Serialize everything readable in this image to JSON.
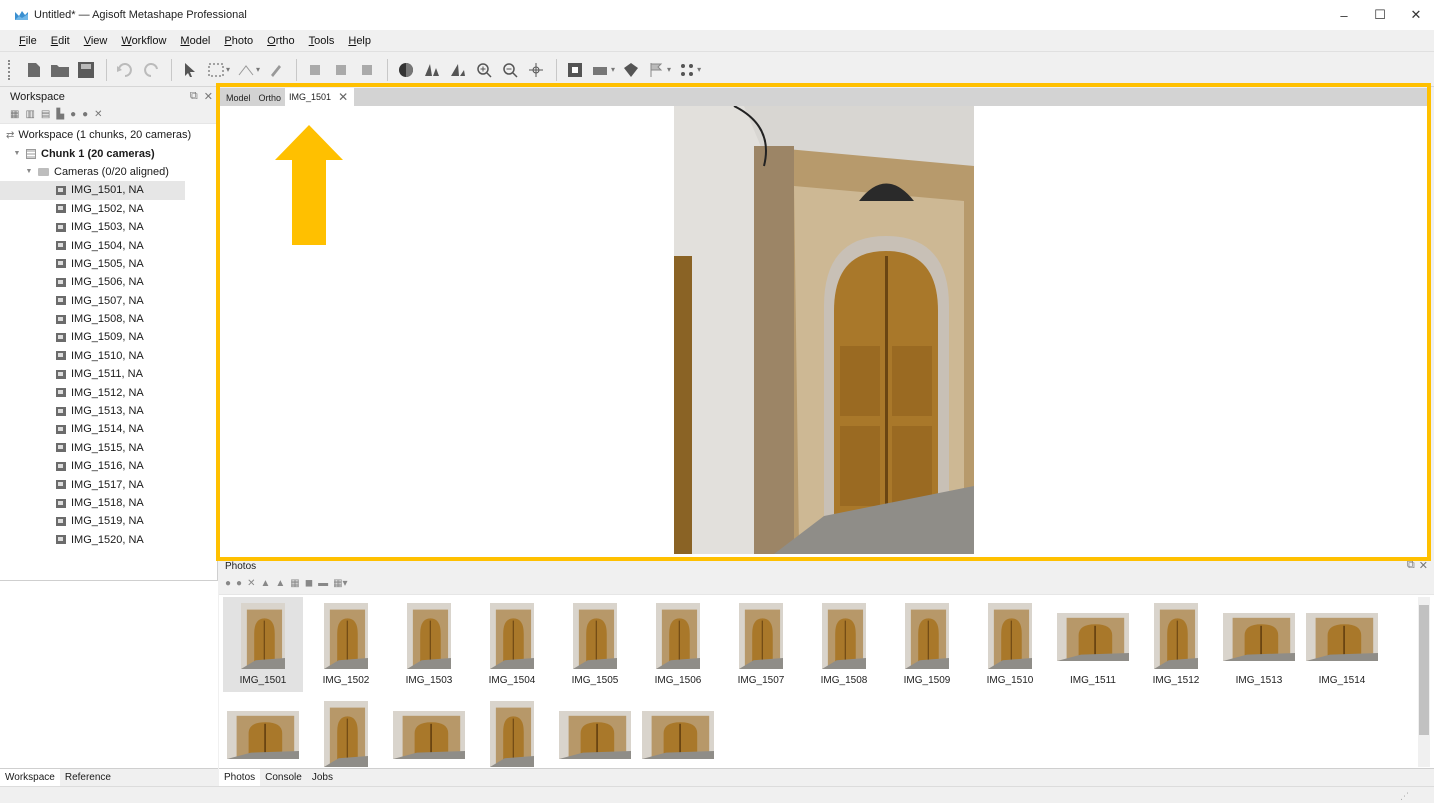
{
  "window": {
    "title": "Untitled* — Agisoft Metashape Professional"
  },
  "window_controls": {
    "minimize": "–",
    "maximize": "☐",
    "close": "✕"
  },
  "menu": [
    {
      "pre": "",
      "u": "F",
      "post": "ile"
    },
    {
      "pre": "",
      "u": "E",
      "post": "dit"
    },
    {
      "pre": "",
      "u": "V",
      "post": "iew"
    },
    {
      "pre": "",
      "u": "W",
      "post": "orkflow"
    },
    {
      "pre": "",
      "u": "M",
      "post": "odel"
    },
    {
      "pre": "",
      "u": "P",
      "post": "hoto"
    },
    {
      "pre": "",
      "u": "O",
      "post": "rtho"
    },
    {
      "pre": "",
      "u": "T",
      "post": "ools"
    },
    {
      "pre": "",
      "u": "H",
      "post": "elp"
    }
  ],
  "workspace": {
    "title": "Workspace",
    "root": "Workspace (1 chunks, 20 cameras)",
    "chunk": "Chunk 1 (20 cameras)",
    "cameras_folder": "Cameras (0/20 aligned)",
    "cameras": [
      "IMG_1501, NA",
      "IMG_1502, NA",
      "IMG_1503, NA",
      "IMG_1504, NA",
      "IMG_1505, NA",
      "IMG_1506, NA",
      "IMG_1507, NA",
      "IMG_1508, NA",
      "IMG_1509, NA",
      "IMG_1510, NA",
      "IMG_1511, NA",
      "IMG_1512, NA",
      "IMG_1513, NA",
      "IMG_1514, NA",
      "IMG_1515, NA",
      "IMG_1516, NA",
      "IMG_1517, NA",
      "IMG_1518, NA",
      "IMG_1519, NA",
      "IMG_1520, NA"
    ],
    "selected_index": 0
  },
  "left_tabs": [
    "Workspace",
    "Reference"
  ],
  "viewer_tabs": [
    {
      "label": "Model",
      "active": false
    },
    {
      "label": "Ortho",
      "active": false
    },
    {
      "label": "IMG_1501",
      "active": true
    }
  ],
  "photos": {
    "title": "Photos",
    "items": [
      {
        "label": "IMG_1501",
        "orientation": "portrait"
      },
      {
        "label": "IMG_1502",
        "orientation": "portrait"
      },
      {
        "label": "IMG_1503",
        "orientation": "portrait"
      },
      {
        "label": "IMG_1504",
        "orientation": "portrait"
      },
      {
        "label": "IMG_1505",
        "orientation": "portrait"
      },
      {
        "label": "IMG_1506",
        "orientation": "portrait"
      },
      {
        "label": "IMG_1507",
        "orientation": "portrait"
      },
      {
        "label": "IMG_1508",
        "orientation": "portrait"
      },
      {
        "label": "IMG_1509",
        "orientation": "portrait"
      },
      {
        "label": "IMG_1510",
        "orientation": "portrait"
      },
      {
        "label": "IMG_1511",
        "orientation": "landscape"
      },
      {
        "label": "IMG_1512",
        "orientation": "portrait"
      },
      {
        "label": "IMG_1513",
        "orientation": "landscape"
      },
      {
        "label": "IMG_1514",
        "orientation": "landscape"
      },
      {
        "label": "",
        "orientation": "landscape"
      },
      {
        "label": "",
        "orientation": "portrait"
      },
      {
        "label": "",
        "orientation": "landscape"
      },
      {
        "label": "",
        "orientation": "portrait"
      },
      {
        "label": "",
        "orientation": "landscape"
      },
      {
        "label": "",
        "orientation": "landscape"
      }
    ]
  },
  "bottom_tabs": [
    "Photos",
    "Console",
    "Jobs"
  ],
  "colors": {
    "highlight": "#ffc000",
    "door": "#a9782a",
    "wall": "#d9d4cc",
    "stone": "#b79869"
  }
}
